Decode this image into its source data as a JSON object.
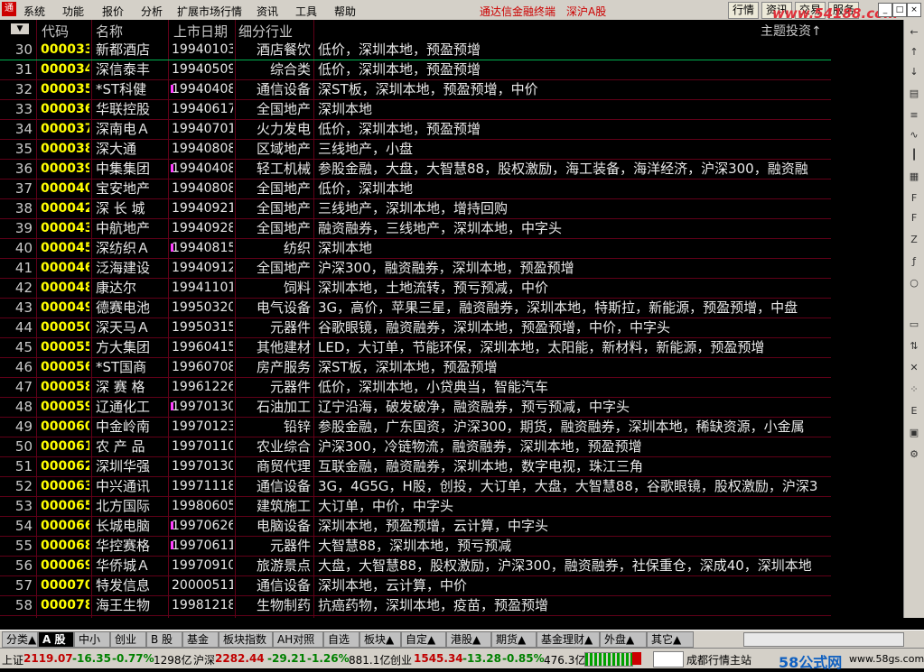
{
  "menu": {
    "items": [
      "系统",
      "功能",
      "报价",
      "分析",
      "扩展市场行情",
      "资讯",
      "工具",
      "帮助"
    ],
    "brand": "通达信金融终端",
    "market": "深沪A股",
    "buttons": [
      "行情",
      "资讯",
      "交易",
      "服务"
    ],
    "watermark": "www.54188.com"
  },
  "header": {
    "sort_icon": "sort-down-icon",
    "code": "代码",
    "name": "名称",
    "listing_date": "上市日期",
    "industry": "细分行业",
    "topic": "主题投资",
    "topic_suffix": "↑"
  },
  "rows": [
    {
      "n": "30",
      "code": "000033",
      "name": "新都酒店",
      "date": "19940103",
      "mark": false,
      "ind": "酒店餐饮",
      "topic": "低价，深圳本地，预盈预增"
    },
    {
      "n": "31",
      "code": "000034",
      "name": "深信泰丰",
      "date": "19940509",
      "mark": false,
      "ind": "综合类",
      "topic": "低价，深圳本地，预盈预增"
    },
    {
      "n": "32",
      "code": "000035",
      "name": "*ST科健",
      "date": "19940408",
      "mark": true,
      "ind": "通信设备",
      "topic": "深ST板，深圳本地，预盈预增，中价"
    },
    {
      "n": "33",
      "code": "000036",
      "name": "华联控股",
      "date": "19940617",
      "mark": false,
      "ind": "全国地产",
      "topic": "深圳本地"
    },
    {
      "n": "34",
      "code": "000037",
      "name": "深南电Ａ",
      "date": "19940701",
      "mark": false,
      "ind": "火力发电",
      "topic": "低价，深圳本地，预盈预增"
    },
    {
      "n": "35",
      "code": "000038",
      "name": "深大通",
      "date": "19940808",
      "mark": false,
      "ind": "区域地产",
      "topic": "三线地产，小盘"
    },
    {
      "n": "36",
      "code": "000039",
      "name": "中集集团",
      "date": "19940408",
      "mark": true,
      "ind": "轻工机械",
      "topic": "参股金融，大盘，大智慧88，股权激励，海工装备，海洋经济，沪深300，融资融"
    },
    {
      "n": "37",
      "code": "000040",
      "name": "宝安地产",
      "date": "19940808",
      "mark": false,
      "ind": "全国地产",
      "topic": "低价，深圳本地"
    },
    {
      "n": "38",
      "code": "000042",
      "name": "深 长 城",
      "date": "19940921",
      "mark": false,
      "ind": "全国地产",
      "topic": "三线地产，深圳本地，增持回购"
    },
    {
      "n": "39",
      "code": "000043",
      "name": "中航地产",
      "date": "19940928",
      "mark": false,
      "ind": "全国地产",
      "topic": "融资融券，三线地产，深圳本地，中字头"
    },
    {
      "n": "40",
      "code": "000045",
      "name": "深纺织Ａ",
      "date": "19940815",
      "mark": true,
      "ind": "纺织",
      "topic": "深圳本地"
    },
    {
      "n": "41",
      "code": "000046",
      "name": "泛海建设",
      "date": "19940912",
      "mark": false,
      "ind": "全国地产",
      "topic": "沪深300，融资融券，深圳本地，预盈预增"
    },
    {
      "n": "42",
      "code": "000048",
      "name": "康达尔",
      "date": "19941101",
      "mark": false,
      "ind": "饲料",
      "topic": "深圳本地，土地流转，预亏预减，中价"
    },
    {
      "n": "43",
      "code": "000049",
      "name": "德赛电池",
      "date": "19950320",
      "mark": false,
      "ind": "电气设备",
      "topic": "3G，高价，苹果三星，融资融券，深圳本地，特斯拉，新能源，预盈预增，中盘"
    },
    {
      "n": "44",
      "code": "000050",
      "name": "深天马Ａ",
      "date": "19950315",
      "mark": false,
      "ind": "元器件",
      "topic": "谷歌眼镜，融资融券，深圳本地，预盈预增，中价，中字头"
    },
    {
      "n": "45",
      "code": "000055",
      "name": "方大集团",
      "date": "19960415",
      "mark": false,
      "ind": "其他建材",
      "topic": "LED，大订单，节能环保，深圳本地，太阳能，新材料，新能源，预盈预增"
    },
    {
      "n": "46",
      "code": "000056",
      "name": "*ST国商",
      "date": "19960708",
      "mark": false,
      "ind": "房产服务",
      "topic": "深ST板，深圳本地，预盈预增"
    },
    {
      "n": "47",
      "code": "000058",
      "name": "深 赛 格",
      "date": "19961226",
      "mark": false,
      "ind": "元器件",
      "topic": "低价，深圳本地，小贷典当，智能汽车"
    },
    {
      "n": "48",
      "code": "000059",
      "name": "辽通化工",
      "date": "19970130",
      "mark": true,
      "ind": "石油加工",
      "topic": "辽宁沿海，破发破净，融资融券，预亏预减，中字头"
    },
    {
      "n": "49",
      "code": "000060",
      "name": "中金岭南",
      "date": "19970123",
      "mark": false,
      "ind": "铅锌",
      "topic": "参股金融，广东国资，沪深300，期货，融资融券，深圳本地，稀缺资源，小金属"
    },
    {
      "n": "50",
      "code": "000061",
      "name": "农 产 品",
      "date": "19970110",
      "mark": false,
      "ind": "农业综合",
      "topic": "沪深300，冷链物流，融资融券，深圳本地，预盈预增"
    },
    {
      "n": "51",
      "code": "000062",
      "name": "深圳华强",
      "date": "19970130",
      "mark": false,
      "ind": "商贸代理",
      "topic": "互联金融，融资融券，深圳本地，数字电视，珠江三角"
    },
    {
      "n": "52",
      "code": "000063",
      "name": "中兴通讯",
      "date": "19971118",
      "mark": false,
      "ind": "通信设备",
      "topic": "3G，4G5G，H股，创投，大订单，大盘，大智慧88，谷歌眼镜，股权激励，沪深3"
    },
    {
      "n": "53",
      "code": "000065",
      "name": "北方国际",
      "date": "19980605",
      "mark": false,
      "ind": "建筑施工",
      "topic": "大订单，中价，中字头"
    },
    {
      "n": "54",
      "code": "000066",
      "name": "长城电脑",
      "date": "19970626",
      "mark": true,
      "ind": "电脑设备",
      "topic": "深圳本地，预盈预增，云计算，中字头"
    },
    {
      "n": "55",
      "code": "000068",
      "name": "华控赛格",
      "date": "19970611",
      "mark": true,
      "ind": "元器件",
      "topic": "大智慧88，深圳本地，预亏预减"
    },
    {
      "n": "56",
      "code": "000069",
      "name": "华侨城Ａ",
      "date": "19970910",
      "mark": false,
      "ind": "旅游景点",
      "topic": "大盘，大智慧88，股权激励，沪深300，融资融券，社保重仓，深成40，深圳本地"
    },
    {
      "n": "57",
      "code": "000070",
      "name": "特发信息",
      "date": "20000511",
      "mark": false,
      "ind": "通信设备",
      "topic": "深圳本地，云计算，中价"
    },
    {
      "n": "58",
      "code": "000078",
      "name": "海王生物",
      "date": "19981218",
      "mark": false,
      "ind": "生物制药",
      "topic": "抗癌药物，深圳本地，疫苗，预盈预增"
    }
  ],
  "tabs": [
    "分类▲",
    "A 股",
    "中小",
    "创业",
    "B 股",
    "基金",
    "板块指数",
    "AH对照",
    "自选",
    "板块▲",
    "自定▲",
    "港股▲",
    "期货▲",
    "基金理财▲",
    "外盘▲",
    "其它▲"
  ],
  "active_tab": "A 股",
  "status": {
    "sh_label": "上证",
    "sh_value": "2119.07",
    "sh_change": "-16.35",
    "sh_pct": "-0.77%",
    "sh_amount": "1298亿",
    "hs_label": "沪深",
    "hs_value": "2282.44",
    "hs_change": "-29.21",
    "hs_pct": "-1.26%",
    "hs_amount": "881.1亿",
    "cy_label": "创业",
    "cy_value": "1545.34",
    "cy_change": "-13.28",
    "cy_pct": "-0.85%",
    "cy_amount": "476.3亿",
    "server": "成都行情主站",
    "logo_58": "58公式网",
    "url_58": "www.58gs.com"
  },
  "colors": {
    "code": "#ffff00",
    "gridline": "#600018",
    "selection": "#00b050",
    "mark": "#ff40ff",
    "down": "#008000",
    "brand": "#cc0000"
  }
}
